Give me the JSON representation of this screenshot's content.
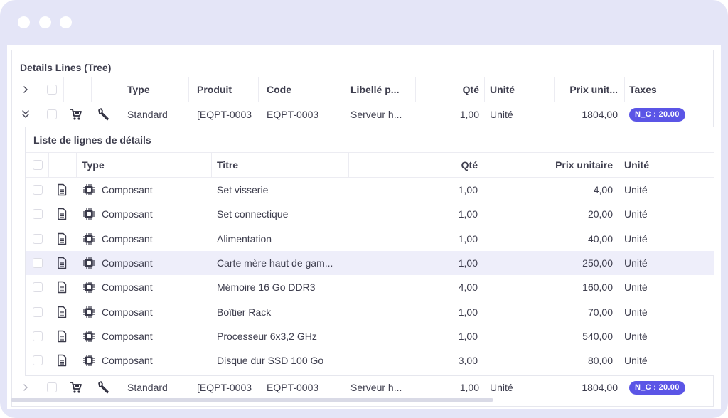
{
  "window": {
    "chrome_color": "#e4e5f7",
    "accent": "#5b55e6"
  },
  "panel": {
    "title": "Details Lines (Tree)"
  },
  "main_table": {
    "columns": {
      "type": "Type",
      "produit": "Produit",
      "code": "Code",
      "libelle": "Libellé p...",
      "qte": "Qté",
      "unite": "Unité",
      "prix": "Prix unit...",
      "taxes": "Taxes"
    },
    "rows": [
      {
        "expanded": true,
        "type": "Standard",
        "produit": "[EQPT-0003",
        "code": "EQPT-0003",
        "libelle": "Serveur h...",
        "qte": "1,00",
        "unite": "Unité",
        "prix": "1804,00",
        "tax": "N_C : 20.00"
      },
      {
        "expanded": false,
        "type": "Standard",
        "produit": "[EQPT-0003",
        "code": "EQPT-0003",
        "libelle": "Serveur h...",
        "qte": "1,00",
        "unite": "Unité",
        "prix": "1804,00",
        "tax": "N_C : 20.00"
      }
    ]
  },
  "sub_table": {
    "title": "Liste de lignes de détails",
    "columns": {
      "type": "Type",
      "titre": "Titre",
      "qte": "Qté",
      "prix": "Prix unitaire",
      "unite": "Unité"
    },
    "rows": [
      {
        "type": "Composant",
        "titre": "Set visserie",
        "qte": "1,00",
        "prix": "4,00",
        "unite": "Unité"
      },
      {
        "type": "Composant",
        "titre": "Set connectique",
        "qte": "1,00",
        "prix": "20,00",
        "unite": "Unité"
      },
      {
        "type": "Composant",
        "titre": "Alimentation",
        "qte": "1,00",
        "prix": "40,00",
        "unite": "Unité"
      },
      {
        "type": "Composant",
        "titre": "Carte mère haut de gam...",
        "qte": "1,00",
        "prix": "250,00",
        "unite": "Unité",
        "highlighted": true
      },
      {
        "type": "Composant",
        "titre": "Mémoire 16 Go DDR3",
        "qte": "4,00",
        "prix": "160,00",
        "unite": "Unité"
      },
      {
        "type": "Composant",
        "titre": "Boîtier Rack",
        "qte": "1,00",
        "prix": "70,00",
        "unite": "Unité"
      },
      {
        "type": "Composant",
        "titre": "Processeur 6x3,2 GHz",
        "qte": "1,00",
        "prix": "540,00",
        "unite": "Unité"
      },
      {
        "type": "Composant",
        "titre": "Disque dur SSD 100 Go",
        "qte": "3,00",
        "prix": "80,00",
        "unite": "Unité"
      }
    ]
  },
  "icons": {
    "expand": "chevron-right-icon",
    "collapse": "double-chevron-down-icon",
    "cart": "cart-icon",
    "tool": "wrench-icon",
    "doc": "document-icon",
    "chip": "chip-icon"
  }
}
